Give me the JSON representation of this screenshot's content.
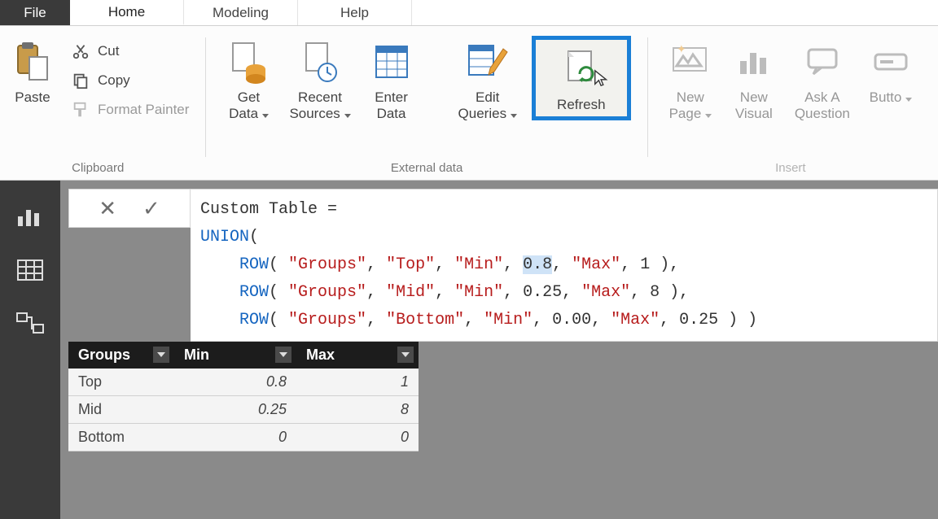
{
  "tabs": {
    "file": "File",
    "home": "Home",
    "modeling": "Modeling",
    "help": "Help",
    "active": "Home"
  },
  "ribbon": {
    "clipboard": {
      "label": "Clipboard",
      "paste": "Paste",
      "cut": "Cut",
      "copy": "Copy",
      "format_painter": "Format Painter"
    },
    "external": {
      "label": "External data",
      "get_data": "Get\nData",
      "recent_sources": "Recent\nSources",
      "enter_data": "Enter\nData",
      "edit_queries": "Edit\nQueries",
      "refresh": "Refresh"
    },
    "insert": {
      "label": "Insert",
      "new_page": "New\nPage",
      "new_visual": "New\nVisual",
      "ask_a_question": "Ask A\nQuestion",
      "buttons": "Butto"
    }
  },
  "formula": {
    "prefix": "Custom Table = ",
    "rows": [
      {
        "group": "Top",
        "min": "0.8",
        "max": "1",
        "min_selected": true
      },
      {
        "group": "Mid",
        "min": "0.25",
        "max": "8"
      },
      {
        "group": "Bottom",
        "min": "0.00",
        "max": "0.25"
      }
    ]
  },
  "table": {
    "columns": [
      "Groups",
      "Min",
      "Max"
    ],
    "rows": [
      {
        "group": "Top",
        "min": "0.8",
        "max": "1"
      },
      {
        "group": "Mid",
        "min": "0.25",
        "max": "8"
      },
      {
        "group": "Bottom",
        "min": "0",
        "max": "0"
      }
    ]
  }
}
